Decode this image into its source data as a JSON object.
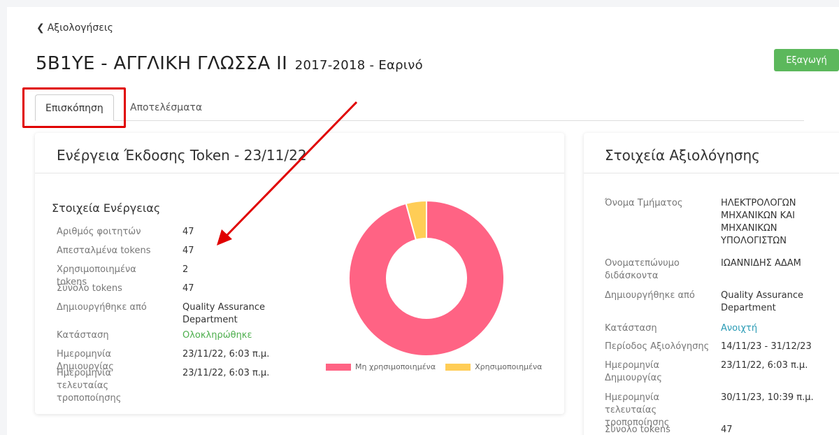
{
  "nav": {
    "back_label": "Αξιολογήσεις"
  },
  "header": {
    "title": "5Β1ΥΕ - ΑΓΓΛΙΚΗ ΓΛΩΣΣΑ II",
    "subtitle": "2017-2018 - Εαρινό",
    "export_label": "Εξαγωγή"
  },
  "tabs": [
    {
      "label": "Επισκόπηση",
      "active": true
    },
    {
      "label": "Αποτελέσματα",
      "active": false
    }
  ],
  "action_card": {
    "title": "Ενέργεια Έκδοσης Token - 23/11/22",
    "section_title": "Στοιχεία Ενέργειας",
    "rows": [
      {
        "key": "Αριθμός φοιτητών",
        "value": "47"
      },
      {
        "key": "Απεσταλμένα tokens",
        "value": "47"
      },
      {
        "key": "Χρησιμοποιημένα tokens",
        "value": "2"
      },
      {
        "key": "Σύνολο tokens",
        "value": "47"
      },
      {
        "key": "Δημιουργήθηκε από",
        "value": "Quality Assurance Department"
      },
      {
        "key": "Κατάσταση",
        "value": "Ολοκληρώθηκε"
      },
      {
        "key": "Ημερομηνία Δημιουργίας",
        "value": "23/11/22, 6:03 π.μ."
      },
      {
        "key": "Ημερομηνία τελευταίας τροποποίησης",
        "value": "23/11/22, 6:03 π.μ."
      }
    ]
  },
  "chart_data": {
    "type": "pie",
    "categories": [
      "Μη χρησιμοποιημένα",
      "Χρησιμοποιημένα"
    ],
    "values": [
      45,
      2
    ],
    "colors": [
      "#ff6384",
      "#ffcd56"
    ],
    "legend": "bottom"
  },
  "eval_card": {
    "title": "Στοιχεία Αξιολόγησης",
    "rows": [
      {
        "key": "Όνομα Τμήματος",
        "value": "ΗΛΕΚΤΡΟΛΟΓΩΝ ΜΗΧΑΝΙΚΩΝ ΚΑΙ ΜΗΧΑΝΙΚΩΝ ΥΠΟΛΟΓΙΣΤΩΝ"
      },
      {
        "key": "Ονοματεπώνυμο διδάσκοντα",
        "value": "ΙΩΑΝΝΙΔΗΣ ΑΔΑΜ"
      },
      {
        "key": "Δημιουργήθηκε από",
        "value": "Quality Assurance Department"
      },
      {
        "key": "Κατάσταση",
        "value": "Ανοιχτή"
      },
      {
        "key": "Περίοδος Αξιολόγησης",
        "value": "14/11/23 - 31/12/23"
      },
      {
        "key": "Ημερομηνία Δημιουργίας",
        "value": "23/11/22, 6:03 π.μ."
      },
      {
        "key": "Ημερομηνία τελευταίας τροποποίησης",
        "value": "30/11/23, 10:39 π.μ."
      },
      {
        "key": "Σύνολο tokens",
        "value": "47"
      }
    ]
  },
  "colors": {
    "status_done": "#4cae4c",
    "status_open": "#2a9bb5",
    "export_button": "#5cb85c",
    "annotation": "#e00000"
  }
}
